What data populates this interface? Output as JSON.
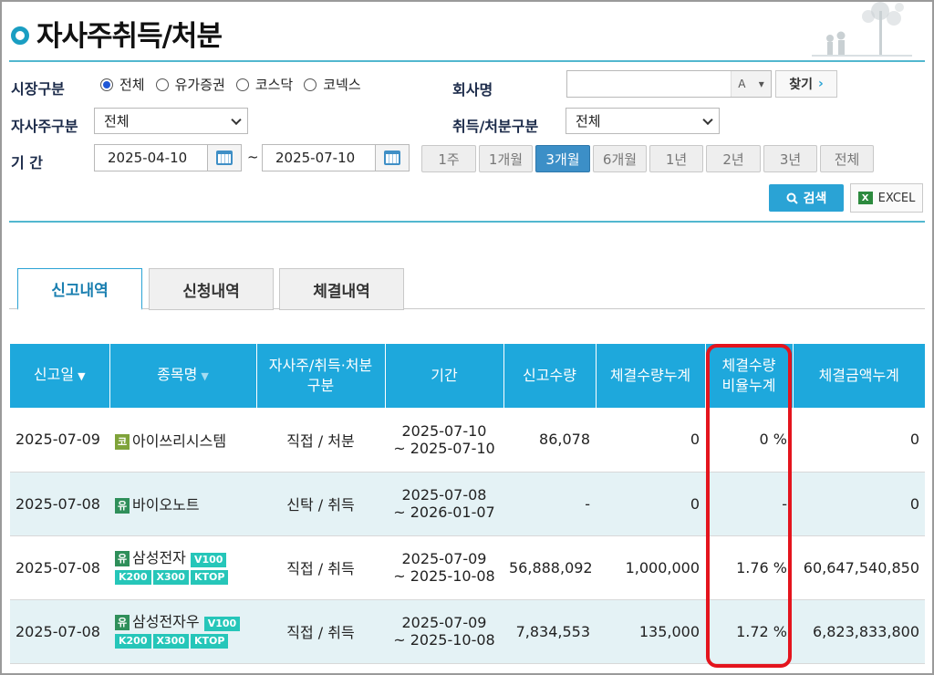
{
  "page": {
    "title": "자사주취득/처분"
  },
  "filters": {
    "market_label": "시장구분",
    "market_options": [
      "전체",
      "유가증권",
      "코스닥",
      "코넥스"
    ],
    "company_label": "회사명",
    "company_value": "",
    "company_caret": "A",
    "find_label": "찾기",
    "treasury_label": "자사주구분",
    "treasury_value": "전체",
    "acq_label": "취득/처분구분",
    "acq_value": "전체",
    "period_label": "기 간",
    "date_from": "2025-04-10",
    "date_to": "2025-07-10",
    "tilde": "~",
    "periods": [
      "1주",
      "1개월",
      "3개월",
      "6개월",
      "1년",
      "2년",
      "3년",
      "전체"
    ],
    "active_period": "3개월",
    "search_label": "검색",
    "excel_label": "EXCEL"
  },
  "tabs": [
    {
      "label": "신고내역",
      "active": true
    },
    {
      "label": "신청내역",
      "active": false
    },
    {
      "label": "체결내역",
      "active": false
    }
  ],
  "table": {
    "headers": [
      "신고일",
      "종목명",
      "자사주/취득·처분구분",
      "기간",
      "신고수량",
      "체결수량누계",
      "체결수량비율누계",
      "체결금액누계"
    ],
    "header_lines": {
      "h2a": "자사주/취득·처분",
      "h2b": "구분",
      "h6a": "체결수량",
      "h6b": "비율누계"
    },
    "rows": [
      {
        "date": "2025-07-09",
        "market": "코",
        "name": "아이쓰리시스템",
        "tags": [],
        "type": "직접 / 처분",
        "from": "2025-07-10",
        "to": "~ 2025-07-10",
        "qty": "86,078",
        "cum_qty": "0",
        "ratio": "0 %",
        "amount": "0"
      },
      {
        "date": "2025-07-08",
        "market": "유",
        "name": "바이오노트",
        "tags": [],
        "type": "신탁 / 취득",
        "from": "2025-07-08",
        "to": "~ 2026-01-07",
        "qty": "-",
        "cum_qty": "0",
        "ratio": "-",
        "amount": "0"
      },
      {
        "date": "2025-07-08",
        "market": "유",
        "name": "삼성전자",
        "tags": [
          "V100",
          "K200",
          "X300",
          "KTOP"
        ],
        "type": "직접 / 취득",
        "from": "2025-07-09",
        "to": "~ 2025-10-08",
        "qty": "56,888,092",
        "cum_qty": "1,000,000",
        "ratio": "1.76 %",
        "amount": "60,647,540,850"
      },
      {
        "date": "2025-07-08",
        "market": "유",
        "name": "삼성전자우",
        "tags": [
          "V100",
          "K200",
          "X300",
          "KTOP"
        ],
        "type": "직접 / 취득",
        "from": "2025-07-09",
        "to": "~ 2025-10-08",
        "qty": "7,834,553",
        "cum_qty": "135,000",
        "ratio": "1.72 %",
        "amount": "6,823,833,800"
      }
    ]
  },
  "colors": {
    "accent": "#1ea8dc",
    "highlight": "#e4141d",
    "active_period": "#3c8fc7"
  }
}
